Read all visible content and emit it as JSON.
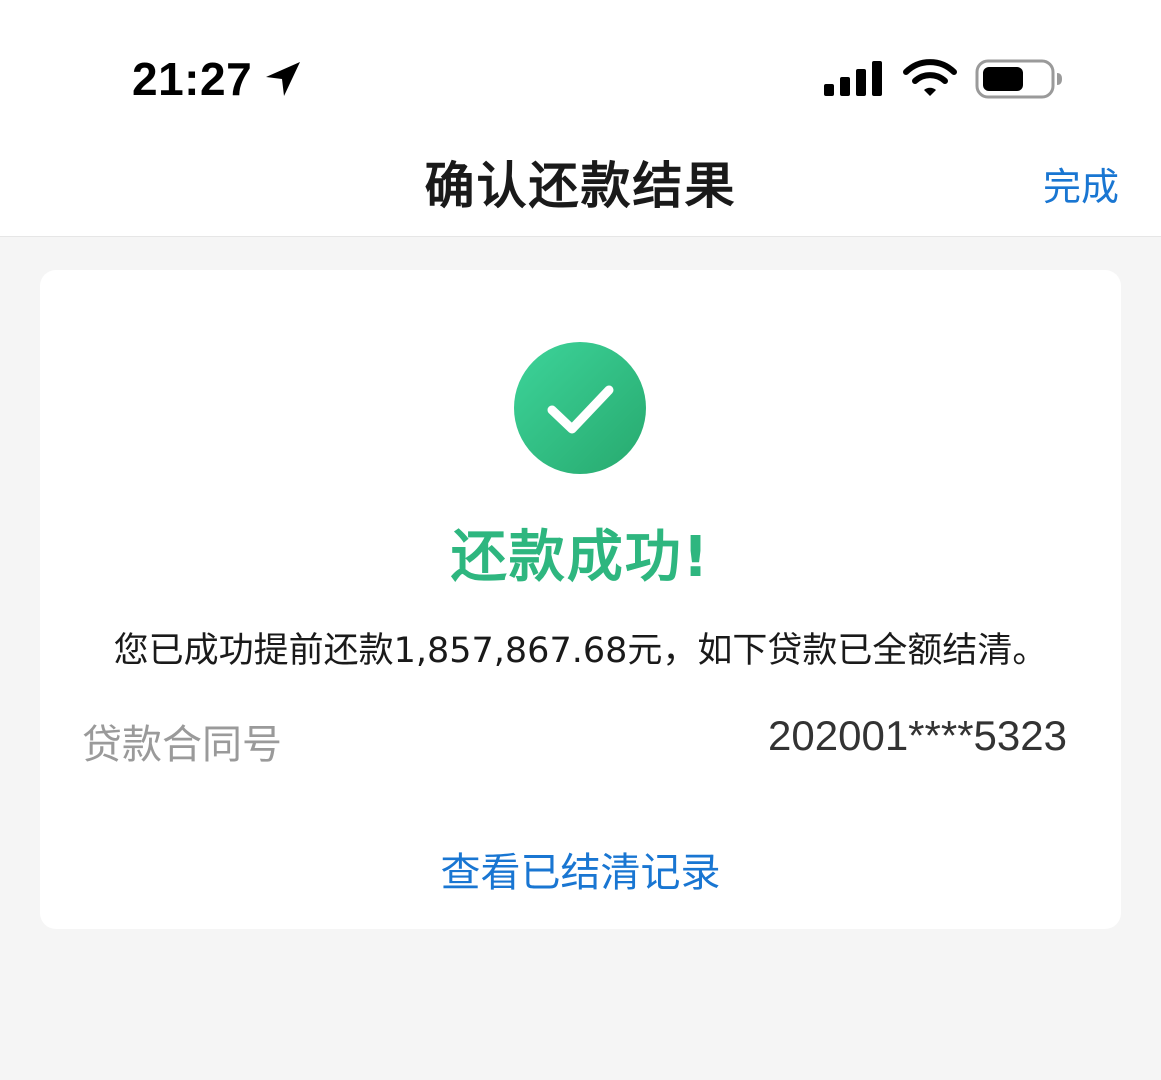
{
  "status_bar": {
    "time": "21:27",
    "icons": [
      "location-arrow-icon",
      "cellular-signal-icon",
      "wifi-icon",
      "battery-icon"
    ]
  },
  "nav": {
    "title": "确认还款结果",
    "done_label": "完成"
  },
  "result": {
    "icon": "check-circle-icon",
    "title": "还款成功!",
    "message": "您已成功提前还款1,857,867.68元，如下贷款已全额结清。"
  },
  "contract": {
    "label": "贷款合同号",
    "value": "202001****5323"
  },
  "records_link": "查看已结清记录",
  "colors": {
    "success": "#2eb67f",
    "link": "#1976d2",
    "background": "#f5f5f5"
  }
}
